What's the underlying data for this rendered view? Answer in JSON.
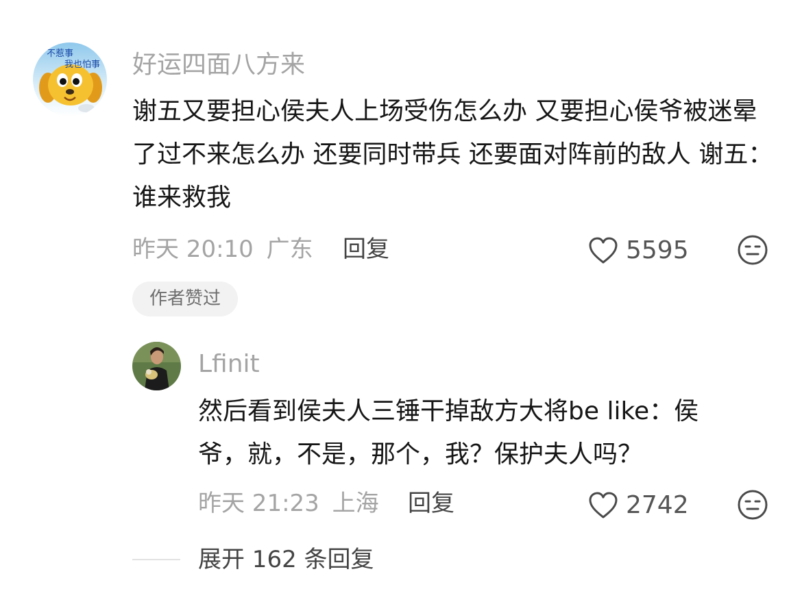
{
  "comments": [
    {
      "username": "好运四面八方来",
      "avatar": {
        "name": "cartoon-dog-avatar",
        "caption_line1": "不惹事",
        "caption_line2": "我也怕事"
      },
      "body": "谢五又要担心侯夫人上场受伤怎么办 又要担心侯爷被迷晕了过不来怎么办 还要同时带兵 还要面对阵前的敌人 谢五：谁来救我",
      "time": "昨天 20:10",
      "location": "广东",
      "reply_label": "回复",
      "like_count": "5595",
      "badge": "作者赞过"
    },
    {
      "username": "Lfinit",
      "avatar": {
        "name": "person-photo-avatar"
      },
      "body": "然后看到侯夫人三锤干掉敌方大将be like：侯爷，就，不是，那个，我？保护夫人吗？",
      "time": "昨天 21:23",
      "location": "上海",
      "reply_label": "回复",
      "like_count": "2742"
    }
  ],
  "expand_replies": "展开 162 条回复",
  "icons": {
    "like": "heart-outline-icon",
    "emoji": "neutral-face-icon"
  },
  "colors": {
    "primary_text": "#161616",
    "secondary_text": "#a4a4a4",
    "badge_bg": "#f2f2f2"
  }
}
